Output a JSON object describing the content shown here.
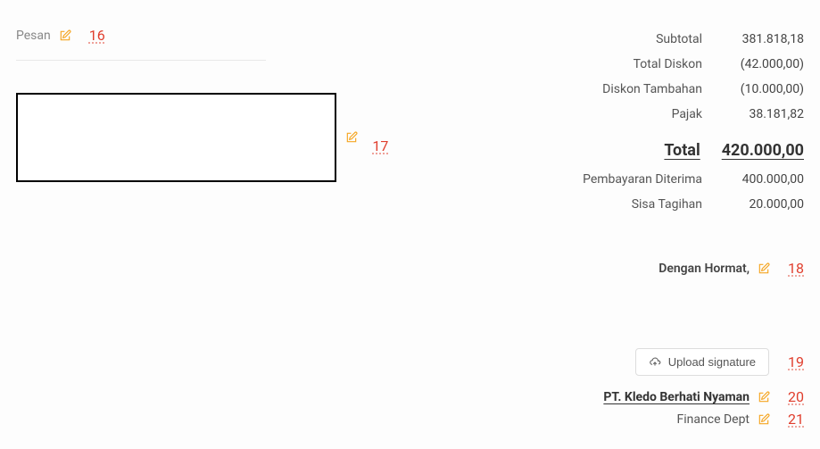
{
  "left": {
    "pesan_label": "Pesan",
    "marker_16": "16",
    "marker_17": "17"
  },
  "totals": {
    "subtotal_label": "Subtotal",
    "subtotal_value": "381.818,18",
    "diskon_label": "Total Diskon",
    "diskon_value": "(42.000,00)",
    "tambahan_label": "Diskon Tambahan",
    "tambahan_value": "(10.000,00)",
    "pajak_label": "Pajak",
    "pajak_value": "38.181,82",
    "total_label": "Total",
    "total_value": "420.000,00",
    "diterima_label": "Pembayaran Diterima",
    "diterima_value": "400.000,00",
    "sisa_label": "Sisa Tagihan",
    "sisa_value": "20.000,00"
  },
  "closing": {
    "text": "Dengan Hormat,",
    "marker_18": "18"
  },
  "signature": {
    "upload_label": "Upload signature",
    "marker_19": "19",
    "company": "PT. Kledo Berhati Nyaman",
    "marker_20": "20",
    "dept": "Finance Dept",
    "marker_21": "21"
  }
}
